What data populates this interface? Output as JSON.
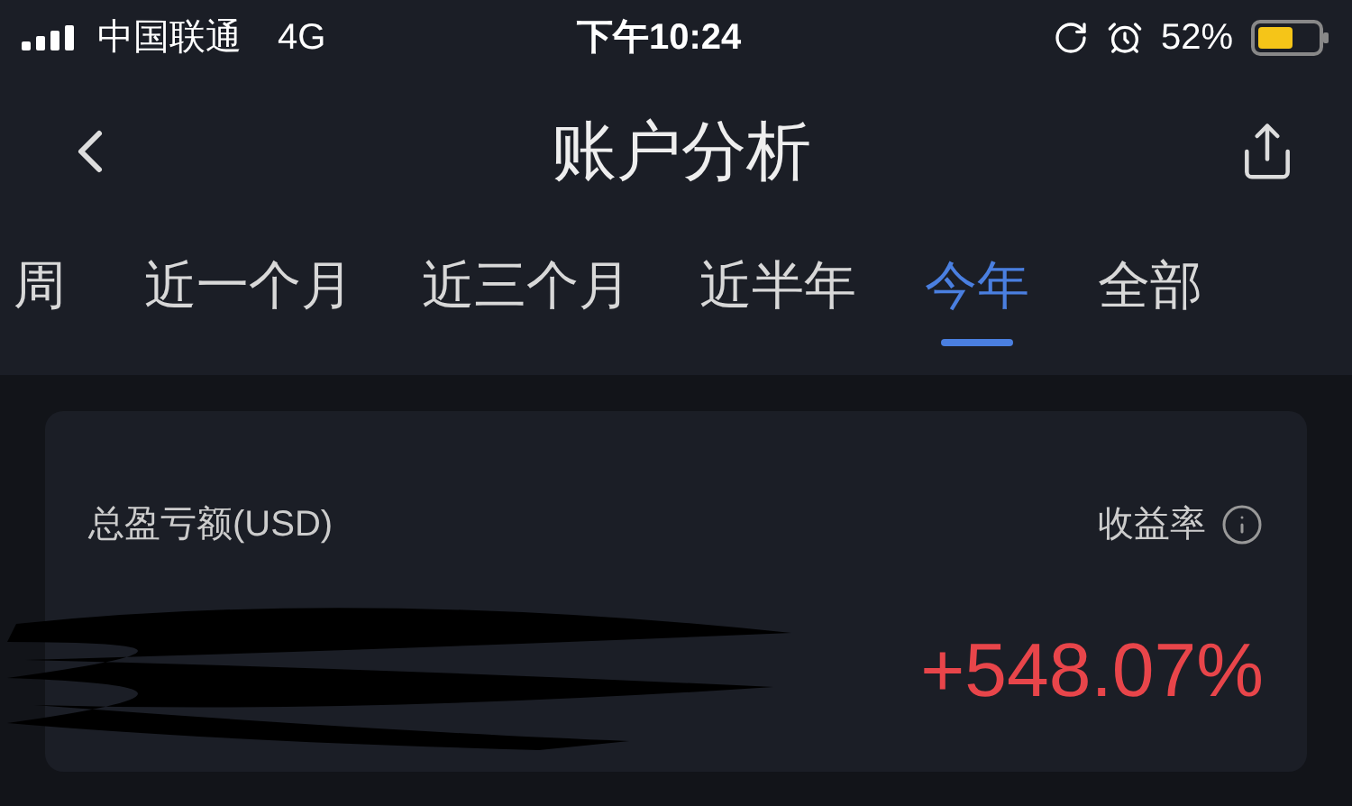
{
  "status_bar": {
    "carrier": "中国联通",
    "network": "4G",
    "time": "下午10:24",
    "battery": "52%"
  },
  "header": {
    "title": "账户分析"
  },
  "tabs": [
    {
      "label": "周",
      "selected": false
    },
    {
      "label": "近一个月",
      "selected": false
    },
    {
      "label": "近三个月",
      "selected": false
    },
    {
      "label": "近半年",
      "selected": false
    },
    {
      "label": "今年",
      "selected": true
    },
    {
      "label": "全部",
      "selected": false
    }
  ],
  "card": {
    "label": "总盈亏额(USD)",
    "info_label": "收益率",
    "return_value": "+548.07%"
  }
}
